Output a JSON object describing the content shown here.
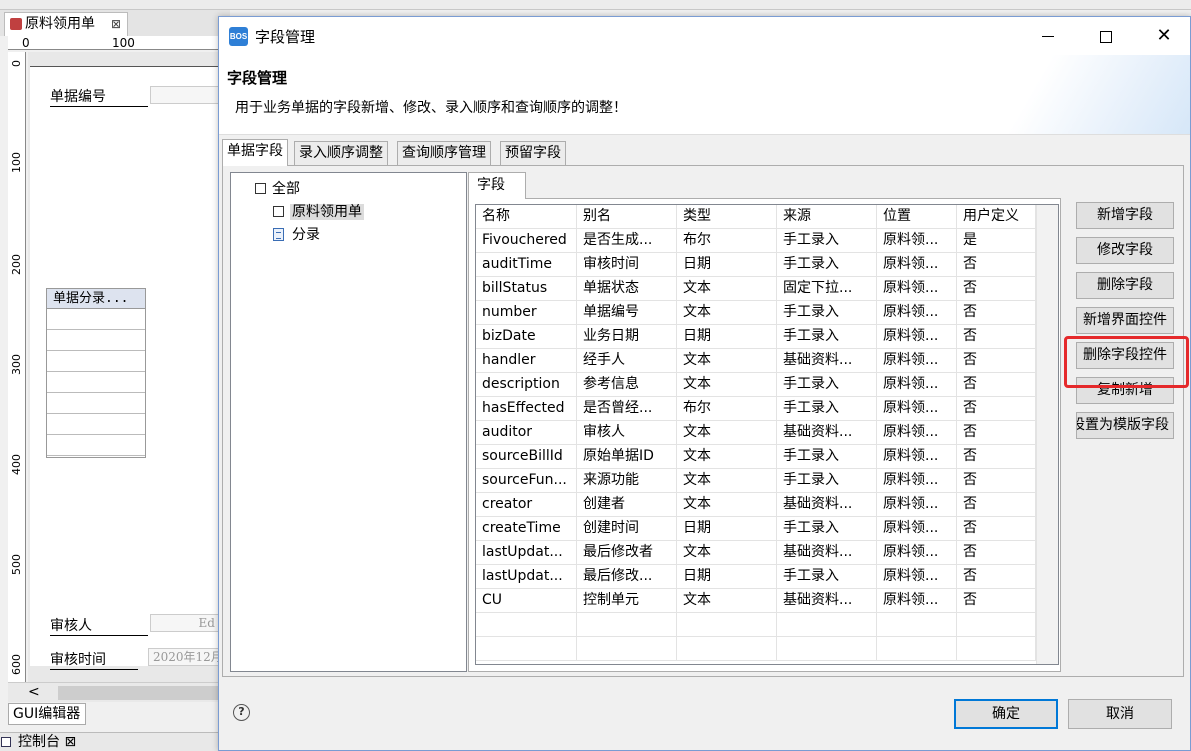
{
  "background": {
    "editor_tab": "原料领用单",
    "ruler_top_label": "100",
    "ruler_top_zero": "0",
    "ruler_left_labels": [
      "0",
      "100",
      "200",
      "300",
      "400",
      "500",
      "600"
    ],
    "labels": {
      "bill_number": "单据编号",
      "auditor": "审核人",
      "audit_time": "审核时间"
    },
    "field_values": {
      "auditor": "Ed",
      "audit_time": "2020年12月"
    },
    "grid_header": "单据分录...",
    "hscroll_arrow": "<",
    "gui_editor_tab": "GUI编辑器",
    "console_tab": "控制台 ⊠"
  },
  "dialog": {
    "title": "字段管理",
    "app_icon_text": "BOS",
    "window_controls": {
      "minimize": "",
      "maximize": "",
      "close": "✕"
    },
    "header": {
      "title": "字段管理",
      "description": "用于业务单据的字段新增、修改、录入顺序和查询顺序的调整！"
    },
    "tabs": [
      "单据字段",
      "录入顺序调整",
      "查询顺序管理",
      "预留字段"
    ],
    "tree": {
      "root": "全部",
      "children": [
        "原料领用单",
        "分录"
      ]
    },
    "inner_tab": "字段",
    "table": {
      "headers": [
        "名称",
        "别名",
        "类型",
        "来源",
        "位置",
        "用户定义"
      ],
      "rows": [
        [
          "Fivouchered",
          "是否生成...",
          "布尔",
          "手工录入",
          "原料领...",
          "是"
        ],
        [
          "auditTime",
          "审核时间",
          "日期",
          "手工录入",
          "原料领...",
          "否"
        ],
        [
          "billStatus",
          "单据状态",
          "文本",
          "固定下拉...",
          "原料领...",
          "否"
        ],
        [
          "number",
          "单据编号",
          "文本",
          "手工录入",
          "原料领...",
          "否"
        ],
        [
          "bizDate",
          "业务日期",
          "日期",
          "手工录入",
          "原料领...",
          "否"
        ],
        [
          "handler",
          "经手人",
          "文本",
          "基础资料...",
          "原料领...",
          "否"
        ],
        [
          "description",
          "参考信息",
          "文本",
          "手工录入",
          "原料领...",
          "否"
        ],
        [
          "hasEffected",
          "是否曾经...",
          "布尔",
          "手工录入",
          "原料领...",
          "否"
        ],
        [
          "auditor",
          "审核人",
          "文本",
          "基础资料...",
          "原料领...",
          "否"
        ],
        [
          "sourceBillId",
          "原始单据ID",
          "文本",
          "手工录入",
          "原料领...",
          "否"
        ],
        [
          "sourceFun...",
          "来源功能",
          "文本",
          "手工录入",
          "原料领...",
          "否"
        ],
        [
          "creator",
          "创建者",
          "文本",
          "基础资料...",
          "原料领...",
          "否"
        ],
        [
          "createTime",
          "创建时间",
          "日期",
          "手工录入",
          "原料领...",
          "否"
        ],
        [
          "lastUpdat...",
          "最后修改者",
          "文本",
          "基础资料...",
          "原料领...",
          "否"
        ],
        [
          "lastUpdat...",
          "最后修改...",
          "日期",
          "手工录入",
          "原料领...",
          "否"
        ],
        [
          "CU",
          "控制单元",
          "文本",
          "基础资料...",
          "原料领...",
          "否"
        ]
      ]
    },
    "side_buttons": [
      "新增字段",
      "修改字段",
      "删除字段",
      "新增界面控件",
      "删除字段控件",
      "复制新增",
      "设置为模版字段"
    ],
    "footer": {
      "help": "?",
      "ok": "确定",
      "cancel": "取消"
    },
    "colors": {
      "highlight": "#e5292b",
      "primary_border": "#0078d7"
    }
  }
}
